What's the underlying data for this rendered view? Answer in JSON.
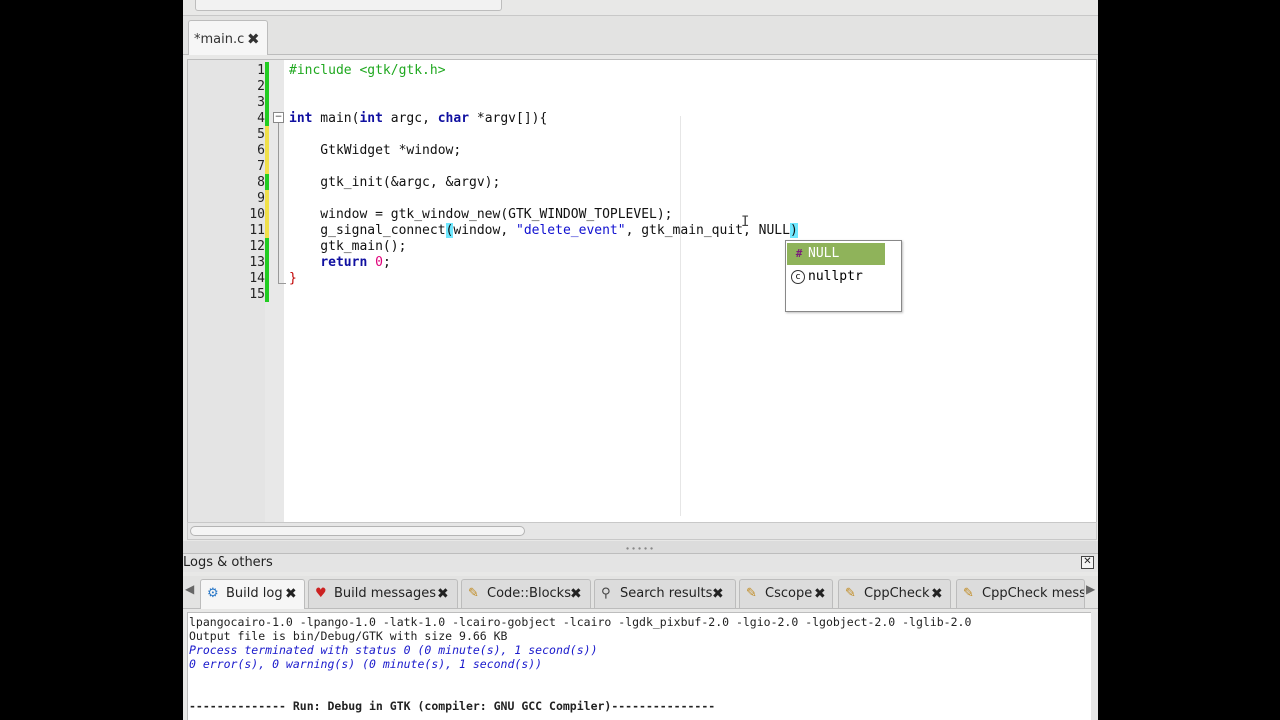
{
  "editor": {
    "tab_label": "*main.c",
    "tab_close": "✖",
    "line_numbers": [
      "1",
      "2",
      "3",
      "4",
      "5",
      "6",
      "7",
      "8",
      "9",
      "10",
      "11",
      "12",
      "13",
      "14",
      "15"
    ]
  },
  "code": {
    "l1": "#include <gtk/gtk.h>",
    "l4_int1": "int",
    "l4_main": " main(",
    "l4_int2": "int",
    "l4_argc": " argc, ",
    "l4_char": "char",
    "l4_rest": " *argv[]){",
    "l6": "    GtkWidget *window;",
    "l8": "    gtk_init(&argc, &argv);",
    "l10": "    window = gtk_window_new(GTK_WINDOW_TOPLEVEL);",
    "l11_a": "    g_signal_connect",
    "l11_paren_open": "(",
    "l11_b": "window, ",
    "l11_str": "\"delete_event\"",
    "l11_c": ", gtk_main_quit, NULL",
    "l11_paren_close": ")",
    "l12": "    gtk_main();",
    "l13_kw": "return",
    "l13_num": "0",
    "l13_end": ";",
    "l14": "}"
  },
  "autocomplete": {
    "items": [
      {
        "icon": "#",
        "label": "NULL"
      },
      {
        "icon": "c",
        "label": "nullptr"
      }
    ]
  },
  "logs": {
    "title": "Logs & others",
    "close": "✕",
    "tabs": [
      {
        "icon": "⚙",
        "label": "Build log",
        "close": "✖"
      },
      {
        "icon": "♥",
        "label": "Build messages",
        "close": "✖"
      },
      {
        "icon": "✎",
        "label": "Code::Blocks",
        "close": "✖"
      },
      {
        "icon": "⚲",
        "label": "Search results",
        "close": "✖"
      },
      {
        "icon": "✎",
        "label": "Cscope",
        "close": "✖"
      },
      {
        "icon": "✎",
        "label": "CppCheck",
        "close": "✖"
      },
      {
        "icon": "✎",
        "label": "CppCheck messa",
        "close": ""
      }
    ],
    "lines": [
      "lpangocairo-1.0 -lpango-1.0 -latk-1.0 -lcairo-gobject -lcairo -lgdk_pixbuf-2.0 -lgio-2.0 -lgobject-2.0 -lglib-2.0",
      "Output file is bin/Debug/GTK with size 9.66 KB",
      "Process terminated with status 0 (0 minute(s), 1 second(s))",
      "0 error(s), 0 warning(s) (0 minute(s), 1 second(s))",
      "",
      "",
      "-------------- Run: Debug in GTK (compiler: GNU GCC Compiler)---------------"
    ]
  },
  "colors": {
    "preprocessor": "#1fa81f",
    "keyword": "#1010a0",
    "string": "#1010d0",
    "number": "#e0007a",
    "autocomplete_selected": "#8fb35a",
    "brace_match": "#6fe8ff",
    "gutter_saved": "#22cc22",
    "gutter_modified": "#f0e04a"
  }
}
